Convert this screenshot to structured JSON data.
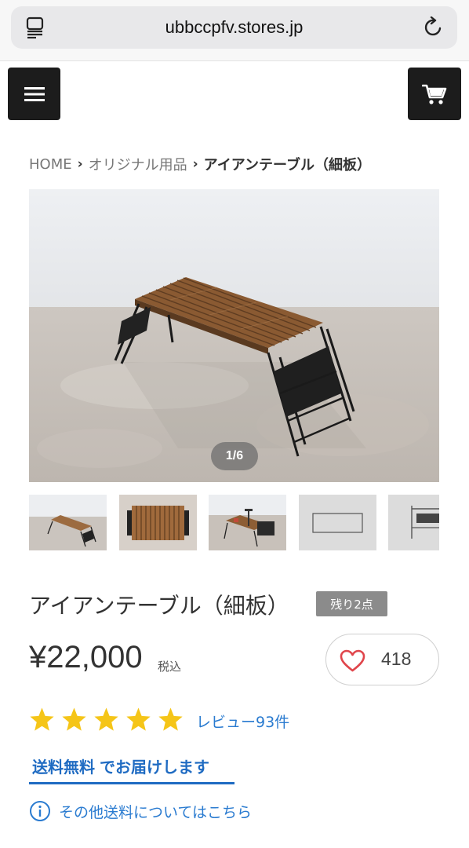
{
  "browser": {
    "url": "ubbccpfv.stores.jp"
  },
  "header": {
    "menu_icon": "hamburger-icon",
    "cart_icon": "cart-icon"
  },
  "breadcrumb": {
    "items": [
      "HOME",
      "オリジナル用品"
    ],
    "current": "アイアンテーブル（細板）"
  },
  "gallery": {
    "counter": "1/6",
    "thumbnail_count": 5
  },
  "product": {
    "title": "アイアンテーブル（細板）",
    "stock_badge": "残り2点",
    "price": "¥22,000",
    "tax_label": "税込",
    "favorites_count": "418",
    "rating_stars": 5,
    "review_link": "レビュー93件",
    "free_shipping_strong": "送料無料",
    "free_shipping_rest": "でお届けします",
    "shipping_info_link": "その他送料についてはこちら"
  },
  "colors": {
    "header_button_bg": "#1c1c1c",
    "link_blue": "#2a7bd0",
    "shipping_blue": "#1f6bc2",
    "star_yellow": "#f5c518",
    "heart_red": "#e0454b",
    "badge_gray": "#8b8b8b"
  }
}
